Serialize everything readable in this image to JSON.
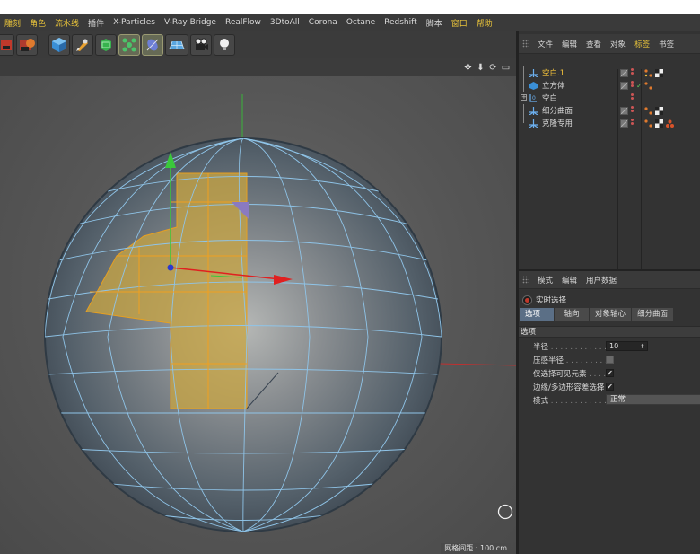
{
  "menubar": {
    "items": [
      "雕刻",
      "角色",
      "流水线",
      "插件",
      "X-Particles",
      "V-Ray Bridge",
      "RealFlow",
      "3DtoAll",
      "Corona",
      "Octane",
      "Redshift",
      "脚本",
      "窗口",
      "帮助"
    ]
  },
  "toolbar": {
    "tools": [
      "scene-render-icon",
      "render-settings-icon",
      "cube-icon",
      "pen-icon",
      "subdivide-icon",
      "cloner-icon",
      "deformer-icon",
      "floor-icon",
      "camera-icon",
      "light-icon"
    ]
  },
  "viewport": {
    "grid_label": "网格间距 : 100 cm"
  },
  "object_manager": {
    "menu": [
      "文件",
      "编辑",
      "查看",
      "对象",
      "标签",
      "书签"
    ],
    "active_menu": "标签",
    "objects": [
      {
        "name": "空白.1",
        "selected": true,
        "icon": "null-icon"
      },
      {
        "name": "立方体",
        "selected": false,
        "icon": "cube-icon"
      },
      {
        "name": "空白",
        "selected": false,
        "icon": "null-icon"
      },
      {
        "name": "细分曲面",
        "selected": false,
        "icon": "subdivision-icon"
      },
      {
        "name": "克隆专用",
        "selected": false,
        "icon": "cloner-icon"
      }
    ]
  },
  "attribute_manager": {
    "menu": [
      "模式",
      "编辑",
      "用户数据"
    ],
    "tool_name": "实时选择",
    "tabs": [
      "选项",
      "轴向",
      "对象轴心",
      "细分曲面"
    ],
    "active_tab": "选项",
    "section_title": "选项",
    "fields": {
      "radius_label": "半径",
      "radius_value": "10",
      "pressure_label": "压感半径",
      "visible_only_label": "仅选择可见元素",
      "edge_poly_label": "边缘/多边形容差选择",
      "mode_label": "模式",
      "mode_value": "正常"
    }
  },
  "colors": {
    "accent": "#e8c33a",
    "selection_fill": "#c9a642",
    "wire": "#8fc4e8"
  }
}
